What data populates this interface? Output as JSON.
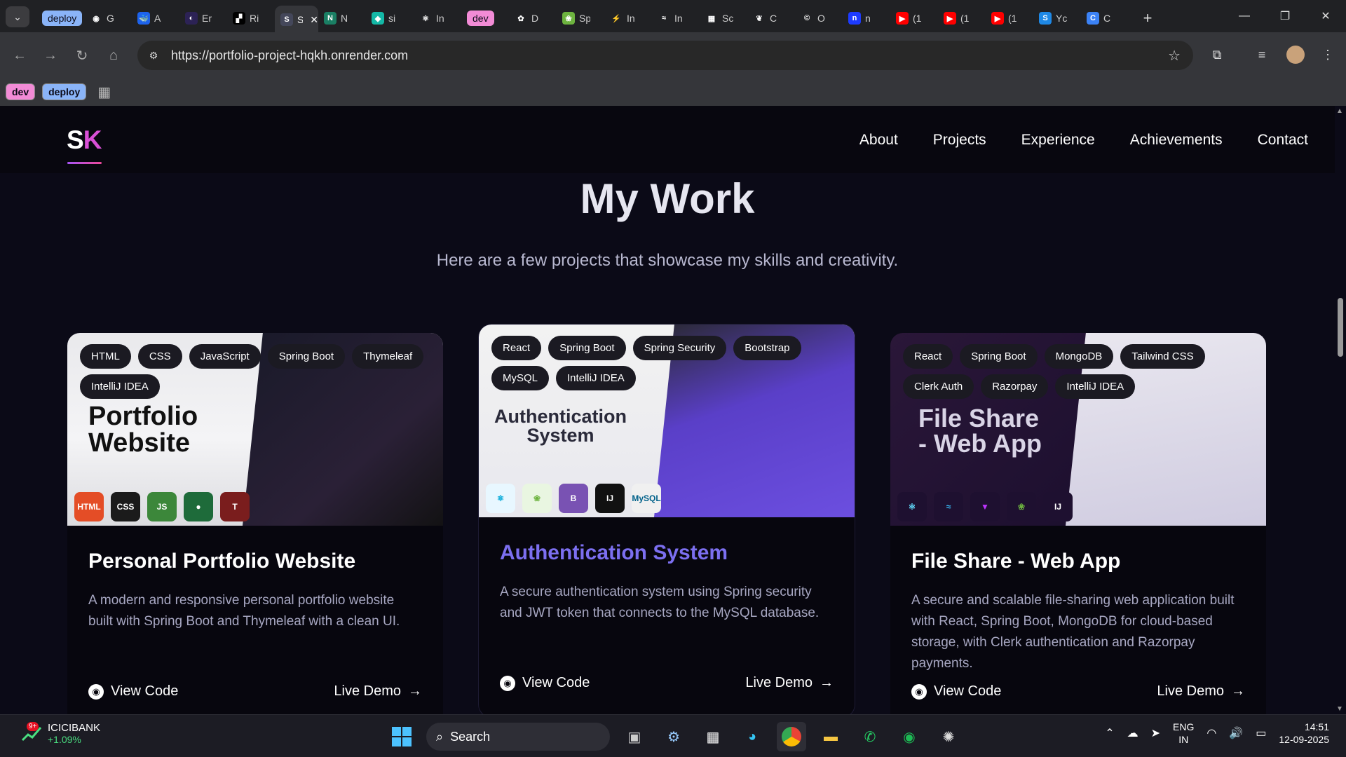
{
  "browser": {
    "tabs": [
      {
        "kind": "chip",
        "label": "deploy",
        "color": "#8ab4f8"
      },
      {
        "title": "G",
        "icon": "github-icon",
        "bg": "#202124",
        "glyph": "◉"
      },
      {
        "title": "A",
        "icon": "docker-icon",
        "bg": "#1d63ed",
        "glyph": "🐳"
      },
      {
        "title": "Er",
        "icon": "eclipse-icon",
        "bg": "#2c2255",
        "glyph": "◐"
      },
      {
        "title": "Ri",
        "icon": "render-icon",
        "bg": "#000000",
        "glyph": "▞"
      },
      {
        "title": "Sa",
        "icon": "portfolio-icon",
        "bg": "#44475a",
        "glyph": "S",
        "active": true
      },
      {
        "title": "N",
        "icon": "netlify-icon",
        "bg": "#1a7f64",
        "glyph": "N"
      },
      {
        "title": "si",
        "icon": "diamond-icon",
        "bg": "#14b8a6",
        "glyph": "◆"
      },
      {
        "title": "In",
        "icon": "react-icon",
        "bg": "#202124",
        "glyph": "⚛"
      },
      {
        "kind": "chip",
        "label": "dev",
        "color": "#f28bd6"
      },
      {
        "title": "D",
        "icon": "cluster-icon",
        "bg": "#202124",
        "glyph": "✿"
      },
      {
        "title": "Sp",
        "icon": "spring-icon",
        "bg": "#6db33f",
        "glyph": "❀"
      },
      {
        "title": "In",
        "icon": "vite-icon",
        "bg": "#202124",
        "glyph": "⚡"
      },
      {
        "title": "In",
        "icon": "tailwind-icon",
        "bg": "#202124",
        "glyph": "≈"
      },
      {
        "title": "Sc",
        "icon": "colorful-icon",
        "bg": "#202124",
        "glyph": "▦"
      },
      {
        "title": "C",
        "icon": "mongodb-icon",
        "bg": "#202124",
        "glyph": "❦"
      },
      {
        "title": "O",
        "icon": "c-circle-icon",
        "bg": "#202124",
        "glyph": "©"
      },
      {
        "title": "n",
        "icon": "n-icon",
        "bg": "#1d3bff",
        "glyph": "n"
      },
      {
        "title": "(1",
        "icon": "youtube-icon",
        "bg": "#ff0000",
        "glyph": "▶"
      },
      {
        "title": "(1",
        "icon": "youtube-icon",
        "bg": "#ff0000",
        "glyph": "▶"
      },
      {
        "title": "(1",
        "icon": "youtube-icon",
        "bg": "#ff0000",
        "glyph": "▶"
      },
      {
        "title": "Yc",
        "icon": "s-icon",
        "bg": "#1e88e5",
        "glyph": "S"
      },
      {
        "title": "C",
        "icon": "c-gradient-icon",
        "bg": "#3b82f6",
        "glyph": "C"
      }
    ],
    "url": "https://portfolio-project-hqkh.onrender.com",
    "bookmarks": [
      {
        "label": "dev",
        "color": "#f28bd6"
      },
      {
        "label": "deploy",
        "color": "#8ab4f8"
      }
    ]
  },
  "site": {
    "logo_s": "S",
    "logo_k": "K",
    "nav": [
      "About",
      "Projects",
      "Experience",
      "Achievements",
      "Contact"
    ],
    "heading": "My Work",
    "subheading": "Here are a few projects that showcase my skills and creativity."
  },
  "projects": [
    {
      "tags": [
        "HTML",
        "CSS",
        "JavaScript",
        "Spring Boot",
        "Thymeleaf",
        "IntelliJ IDEA"
      ],
      "thumb_title": "Portfolio\nWebsite",
      "thumb_tech": [
        "HTML",
        "CSS",
        "JS",
        "●",
        "T"
      ],
      "title": "Personal Portfolio Website",
      "title_color": "#ffffff",
      "desc": "A modern and responsive personal portfolio website built with Spring Boot and Thymeleaf with a clean UI.",
      "code": "View Code",
      "demo": "Live Demo"
    },
    {
      "tags": [
        "React",
        "Spring Boot",
        "Spring Security",
        "Bootstrap",
        "MySQL",
        "IntelliJ IDEA"
      ],
      "thumb_title": "Authentication\nSystem",
      "thumb_tech": [
        "⚛",
        "❀",
        "B",
        "IJ",
        "MySQL"
      ],
      "title": "Authentication System",
      "title_color": "#7c6ff0",
      "desc": "A secure authentication system using Spring security and JWT token that connects to the MySQL database.",
      "code": "View Code",
      "demo": "Live Demo"
    },
    {
      "tags": [
        "React",
        "Spring Boot",
        "MongoDB",
        "Tailwind CSS",
        "Clerk Auth",
        "Razorpay",
        "IntelliJ IDEA"
      ],
      "thumb_title": "File Share\n- Web App",
      "thumb_tech": [
        "⚛",
        "≈",
        "▼",
        "❀",
        "IJ"
      ],
      "title": "File Share - Web App",
      "title_color": "#ffffff",
      "desc": "A secure and scalable file-sharing web application built with React, Spring Boot, MongoDB for cloud-based storage, with Clerk authentication and Razorpay payments.",
      "code": "View Code",
      "demo": "Live Demo"
    }
  ],
  "taskbar": {
    "stock_badge": "9+",
    "stock_name": "ICICIBANK",
    "stock_change": "+1.09%",
    "search": "Search",
    "lang1": "ENG",
    "lang2": "IN",
    "time": "14:51",
    "date": "12-09-2025"
  }
}
